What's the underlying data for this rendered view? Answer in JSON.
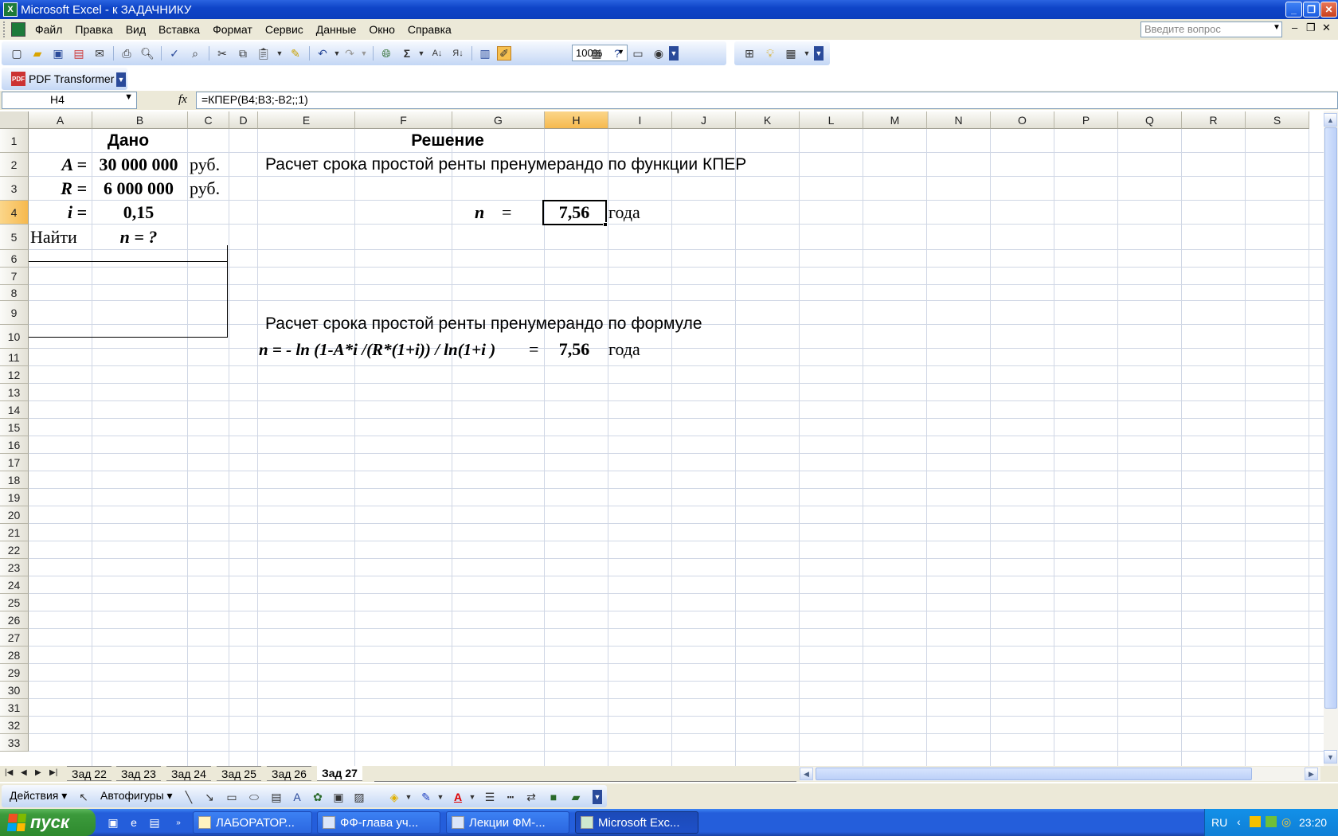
{
  "window": {
    "title": "Microsoft Excel - к ЗАДАЧНИКУ"
  },
  "menu": {
    "items": [
      "Файл",
      "Правка",
      "Вид",
      "Вставка",
      "Формат",
      "Сервис",
      "Данные",
      "Окно",
      "Справка"
    ],
    "ask_placeholder": "Введите вопрос"
  },
  "toolbar": {
    "zoom": "100%",
    "pdf_label": "PDF Transformer"
  },
  "formula_bar": {
    "name_box": "H4",
    "fx": "fx",
    "formula": "=КПЕР(B4;B3;-B2;;1)"
  },
  "grid": {
    "columns": [
      "A",
      "B",
      "C",
      "D",
      "E",
      "F",
      "G",
      "H",
      "I",
      "J",
      "K",
      "L",
      "M",
      "N",
      "O",
      "P",
      "Q",
      "R",
      "S"
    ],
    "rows": [
      "1",
      "2",
      "3",
      "4",
      "5",
      "6",
      "7",
      "8",
      "9",
      "10",
      "11",
      "12",
      "13",
      "14",
      "15",
      "16",
      "17",
      "18",
      "19",
      "20",
      "21",
      "22",
      "23",
      "24",
      "25",
      "26",
      "27",
      "28",
      "29",
      "30",
      "31",
      "32",
      "33"
    ],
    "selected_cell": "H4"
  },
  "cells": {
    "given_header": "Дано",
    "solution_header": "Решение",
    "a_label": "A =",
    "a_value": "30 000 000",
    "a_unit": "руб.",
    "r_label": "R =",
    "r_value": "6 000 000",
    "r_unit": "руб.",
    "i_label": "i =",
    "i_value": "0,15",
    "find_label": "Найти",
    "find_value": "n = ?",
    "method1_title": "Расчет срока простой ренты пренумерандо по функции КПЕР",
    "n_label": "n",
    "n_eq": "=",
    "n_result": "7,56",
    "n_unit": "года",
    "method2_title": "Расчет срока простой ренты пренумерандо по формуле",
    "formula_text": "n = - ln (1-A*i /(R*(1+i)) / ln(1+i )",
    "formula_eq": "=",
    "formula_result": "7,56",
    "formula_unit": "года"
  },
  "sheet_tabs": [
    "Зад 22",
    "Зад 23",
    "Зад 24",
    "Зад 25",
    "Зад 26",
    "Зад 27"
  ],
  "active_sheet": "Зад 27",
  "drawing": {
    "actions": "Действия",
    "autoshapes": "Автофигуры"
  },
  "taskbar": {
    "start": "пуск",
    "tasks": [
      "ЛАБОРАТОР...",
      "ФФ-глава уч...",
      "Лекции ФМ-...",
      "Microsoft Exc..."
    ],
    "lang": "RU",
    "clock": "23:20"
  }
}
